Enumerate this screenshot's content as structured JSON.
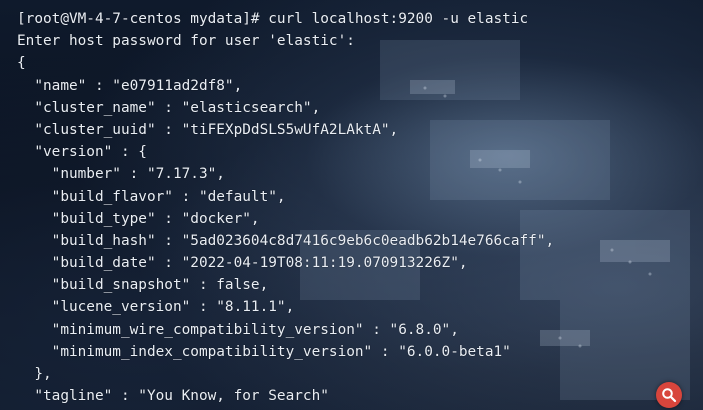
{
  "terminal": {
    "lines": [
      "[root@VM-4-7-centos mydata]# curl localhost:9200 -u elastic",
      "Enter host password for user 'elastic':",
      "{",
      "  \"name\" : \"e07911ad2df8\",",
      "  \"cluster_name\" : \"elasticsearch\",",
      "  \"cluster_uuid\" : \"tiFEXpDdSLS5wUfA2LAktA\",",
      "  \"version\" : {",
      "    \"number\" : \"7.17.3\",",
      "    \"build_flavor\" : \"default\",",
      "    \"build_type\" : \"docker\",",
      "    \"build_hash\" : \"5ad023604c8d7416c9eb6c0eadb62b14e766caff\",",
      "    \"build_date\" : \"2022-04-19T08:11:19.070913226Z\",",
      "    \"build_snapshot\" : false,",
      "    \"lucene_version\" : \"8.11.1\",",
      "    \"minimum_wire_compatibility_version\" : \"6.8.0\",",
      "    \"minimum_index_compatibility_version\" : \"6.0.0-beta1\"",
      "  },",
      "  \"tagline\" : \"You Know, for Search\""
    ]
  },
  "icons": {
    "search": "search-icon"
  },
  "colors": {
    "text": "#e9eef5",
    "background": "#0b1322",
    "search_badge": "#d8453c"
  }
}
